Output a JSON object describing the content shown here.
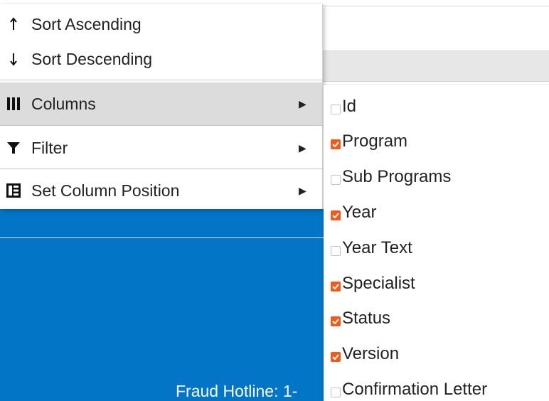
{
  "colors": {
    "footer_blue": "#0275c7",
    "checkbox_checked": "#f25a1a",
    "menu_highlight": "#dcdcdc"
  },
  "column_menu": {
    "items": [
      {
        "icon": "arrow-up-icon",
        "label": "Sort Ascending",
        "has_submenu": false
      },
      {
        "icon": "arrow-down-icon",
        "label": "Sort Descending",
        "has_submenu": false
      },
      {
        "icon": "columns-icon",
        "label": "Columns",
        "has_submenu": true,
        "active": true
      },
      {
        "icon": "filter-icon",
        "label": "Filter",
        "has_submenu": true
      },
      {
        "icon": "set-position-icon",
        "label": "Set Column Position",
        "has_submenu": true
      }
    ]
  },
  "columns_submenu": {
    "options": [
      {
        "label": "Id",
        "checked": false
      },
      {
        "label": "Program",
        "checked": true
      },
      {
        "label": "Sub Programs",
        "checked": false
      },
      {
        "label": "Year",
        "checked": true
      },
      {
        "label": "Year Text",
        "checked": false
      },
      {
        "label": "Specialist",
        "checked": true
      },
      {
        "label": "Status",
        "checked": true
      },
      {
        "label": "Version",
        "checked": true
      },
      {
        "label": "Confirmation Letter",
        "checked": false
      }
    ]
  },
  "footer": {
    "text": "Fraud Hotline: 1-"
  }
}
